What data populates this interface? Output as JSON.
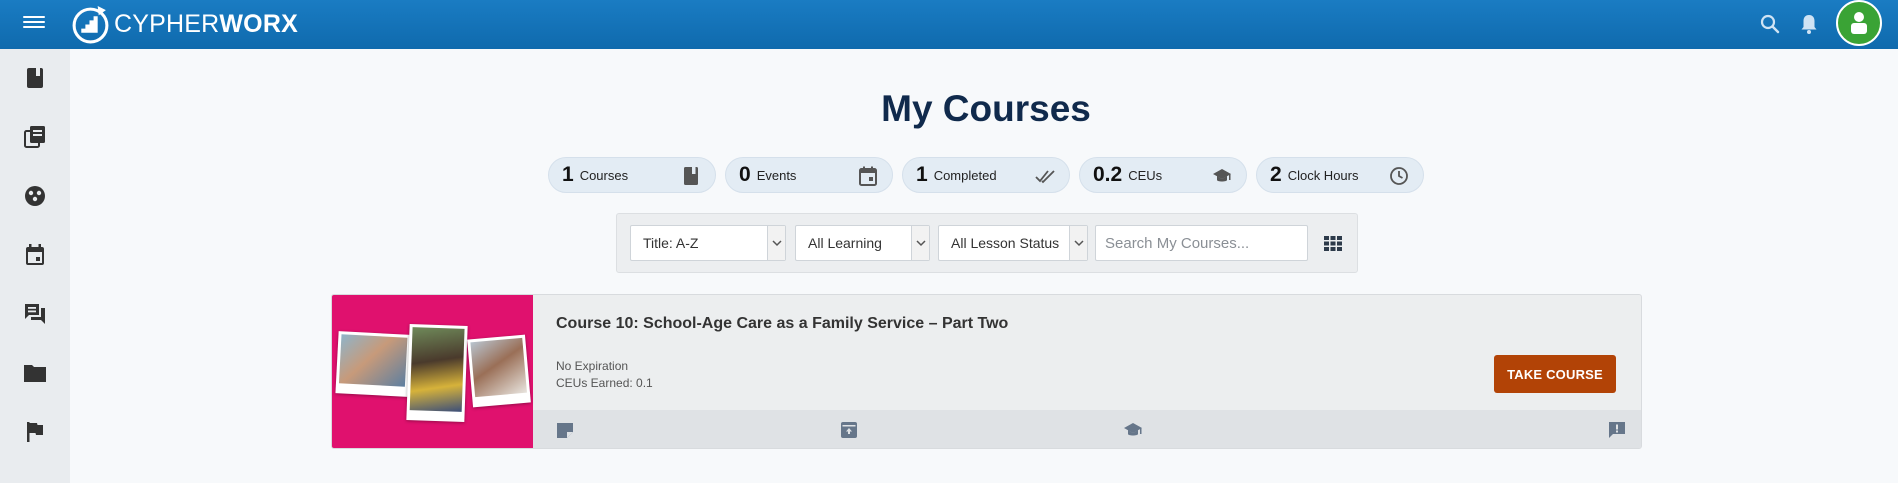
{
  "header": {
    "brand_light": "CYPHER",
    "brand_bold": "WORX",
    "icons": [
      "menu-icon",
      "search-icon",
      "bell-icon",
      "user-avatar"
    ]
  },
  "sidebar": {
    "items": [
      {
        "icon": "book-icon"
      },
      {
        "icon": "library-icon"
      },
      {
        "icon": "community-icon"
      },
      {
        "icon": "calendar-icon"
      },
      {
        "icon": "chat-icon"
      },
      {
        "icon": "folder-icon"
      },
      {
        "icon": "flag-icon"
      }
    ]
  },
  "page": {
    "title": "My Courses"
  },
  "stats": [
    {
      "num": "1",
      "label": "Courses",
      "icon": "book-icon"
    },
    {
      "num": "0",
      "label": "Events",
      "icon": "calendar-icon"
    },
    {
      "num": "1",
      "label": "Completed",
      "icon": "double-check-icon"
    },
    {
      "num": "0.2",
      "label": "CEUs",
      "icon": "graduation-cap-icon"
    },
    {
      "num": "2",
      "label": "Clock Hours",
      "icon": "clock-icon"
    }
  ],
  "filters": {
    "sort": "Title: A-Z",
    "learning": "All Learning",
    "status": "All Lesson Status",
    "search_placeholder": "Search My Courses...",
    "view_icon": "grid-view-icon"
  },
  "course": {
    "title": "Course 10: School-Age Care as a Family Service – Part Two",
    "expiration": "No Expiration",
    "ceus": "CEUs Earned: 0.1",
    "button": "TAKE COURSE",
    "footer_icons": [
      "note-icon",
      "archive-icon",
      "graduation-cap-icon",
      "feedback-icon"
    ]
  },
  "colors": {
    "header": "#0f6aad",
    "avatar": "#3aa335",
    "thumb": "#e0116e",
    "button": "#b24306",
    "title": "#102a4c"
  }
}
